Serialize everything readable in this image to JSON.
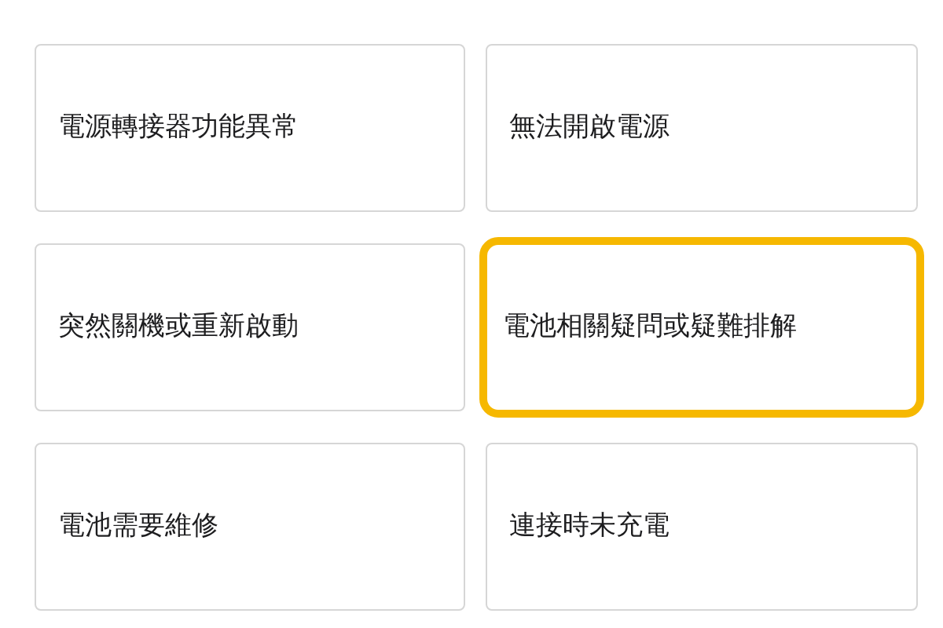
{
  "options": [
    {
      "label": "電源轉接器功能異常",
      "selected": false
    },
    {
      "label": "無法開啟電源",
      "selected": false
    },
    {
      "label": "突然關機或重新啟動",
      "selected": false
    },
    {
      "label": "電池相關疑問或疑難排解",
      "selected": true
    },
    {
      "label": "電池需要維修",
      "selected": false
    },
    {
      "label": "連接時未充電",
      "selected": false
    }
  ]
}
